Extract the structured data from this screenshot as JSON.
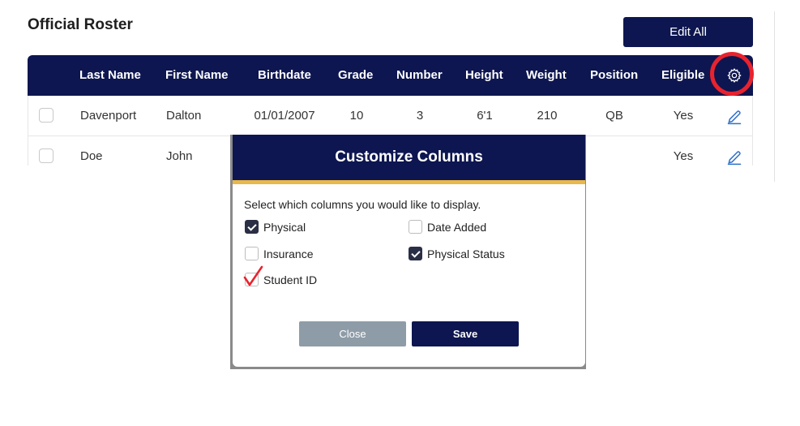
{
  "page": {
    "title": "Official Roster"
  },
  "toolbar": {
    "edit_all_label": "Edit All"
  },
  "table": {
    "headers": [
      "Last Name",
      "First Name",
      "Birthdate",
      "Grade",
      "Number",
      "Height",
      "Weight",
      "Position",
      "Eligible"
    ],
    "settings_icon": "gear-icon",
    "rows": [
      {
        "last": "Davenport",
        "first": "Dalton",
        "birthdate": "01/01/2007",
        "grade": "10",
        "number": "3",
        "height": "6'1",
        "weight": "210",
        "position": "QB",
        "eligible": "Yes"
      },
      {
        "last": "Doe",
        "first": "John",
        "birthdate": "",
        "grade": "",
        "number": "",
        "height": "",
        "weight": "",
        "position": "",
        "eligible": "Yes"
      }
    ]
  },
  "modal": {
    "title": "Customize Columns",
    "description": "Select which columns you would like to display.",
    "options": [
      {
        "label": "Physical",
        "checked": true
      },
      {
        "label": "Date Added",
        "checked": false
      },
      {
        "label": "Insurance",
        "checked": false
      },
      {
        "label": "Physical Status",
        "checked": true
      },
      {
        "label": "Student ID",
        "checked": false
      }
    ],
    "close_label": "Close",
    "save_label": "Save"
  },
  "colors": {
    "navy": "#0d1650",
    "accent_gold": "#e8b84a",
    "annotation_red": "#e8232e",
    "close_gray": "#8e9ca8",
    "edit_icon_blue": "#2f6fc9"
  }
}
